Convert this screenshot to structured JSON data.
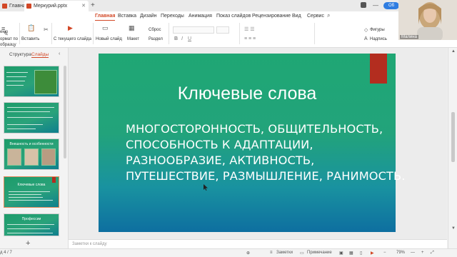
{
  "tabs": {
    "home_label": "Главная",
    "file_label": "Меркурий.pptx",
    "add_label": "+"
  },
  "menu": {
    "items": [
      "Главная",
      "Вставка",
      "Дизайн",
      "Переходы",
      "Анимация",
      "Показ слайдов",
      "Рецензирование",
      "Вид",
      "Сервис"
    ],
    "active": "Главная"
  },
  "toolbar": {
    "menu_label": "еню",
    "format_painter_label": "ормат по образцу",
    "paste_label": "Вставить",
    "from_current_label": "С текущего слайда",
    "new_slide_label": "Новый слайд",
    "layout_label": "Макет",
    "reset_label": "Сброс",
    "section_label": "Раздел",
    "shapes_label": "Фигуры",
    "textbox_label": "Надпись",
    "share_label": "Об"
  },
  "left_panel": {
    "structure_tab": "Структура",
    "slides_tab": "Слайды",
    "slides": [
      {
        "num": "",
        "title": ""
      },
      {
        "num": "",
        "title": ""
      },
      {
        "num": "",
        "title": "Внешность и особенности"
      },
      {
        "num": "",
        "title": "Ключевые слова"
      },
      {
        "num": "",
        "title": "Профессии"
      }
    ],
    "add_label": "+"
  },
  "slide": {
    "title": "Ключевые слова",
    "lines": [
      "МНОГОСТОРОННОСТЬ, ОБЩИТЕЛЬНОСТЬ,",
      "СПОСОБНОСТЬ К АДАПТАЦИИ,",
      "РАЗНООБРАЗИЕ, АКТИВНОСТЬ,",
      "ПУТЕШЕСТВИЕ, РАЗМЫШЛЕНИЕ, РАНИМОСТЬ."
    ]
  },
  "notes": {
    "placeholder": "Заметки к слайду"
  },
  "status": {
    "slide_counter": "д 4 / 7",
    "notes_label": "Заметки",
    "comment_label": "Примечание",
    "zoom": "79%"
  },
  "webcam": {
    "name": "Малина"
  },
  "colors": {
    "accent": "#d24726",
    "slide_green": "#1fa774",
    "slide_blue": "#0e6fa0",
    "slide_marker": "#b32d1f"
  }
}
